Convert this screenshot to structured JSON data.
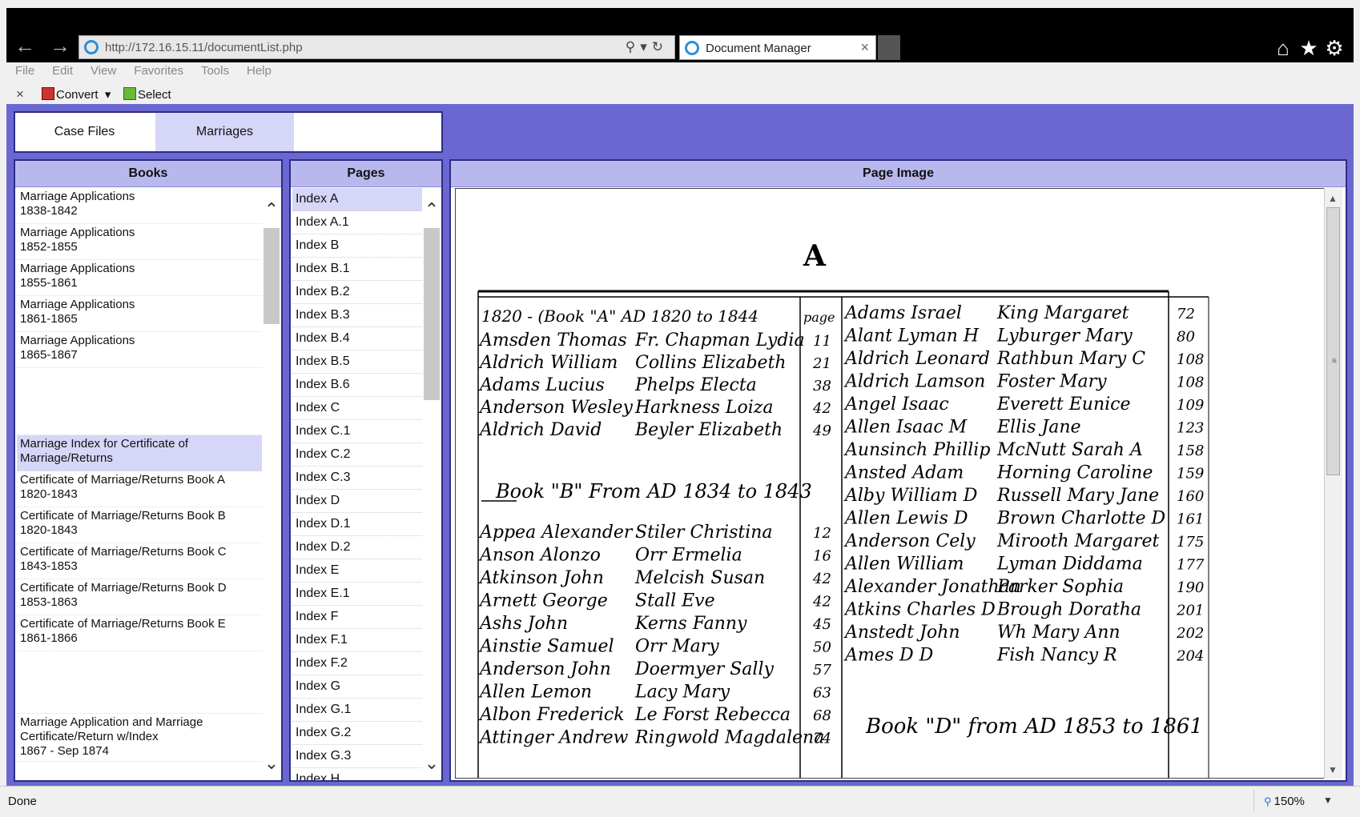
{
  "browser": {
    "url": "http://172.16.15.11/documentList.php",
    "tab_title": "Document Manager",
    "icons": [
      "back-arrow-icon",
      "forward-arrow-icon",
      "search-icon",
      "refresh-icon",
      "home-icon",
      "favorites-star-icon",
      "settings-gear-icon"
    ]
  },
  "menu": {
    "file": "File",
    "edit": "Edit",
    "view": "View",
    "favorites": "Favorites",
    "tools": "Tools",
    "help": "Help"
  },
  "commands": {
    "convert": "Convert",
    "select": "Select"
  },
  "tabs": [
    "Case Files",
    "Marriages"
  ],
  "books": {
    "header": "Books",
    "items": [
      {
        "line1": "Marriage Applications",
        "line2": "1838-1842"
      },
      {
        "line1": "Marriage Applications",
        "line2": "1852-1855"
      },
      {
        "line1": "Marriage Applications",
        "line2": "1855-1861"
      },
      {
        "line1": "Marriage Applications",
        "line2": "1861-1865"
      },
      {
        "line1": "Marriage Applications",
        "line2": "1865-1867"
      },
      {
        "line1": "Marriage Index for Certificate of",
        "line2": "Marriage/Returns"
      },
      {
        "line1": "Certificate of Marriage/Returns Book A",
        "line2": "1820-1843"
      },
      {
        "line1": "Certificate of Marriage/Returns Book B",
        "line2": "1820-1843"
      },
      {
        "line1": "Certificate of Marriage/Returns Book C",
        "line2": "1843-1853"
      },
      {
        "line1": "Certificate of Marriage/Returns Book D",
        "line2": "1853-1863"
      },
      {
        "line1": "Certificate of Marriage/Returns Book E",
        "line2": "1861-1866"
      },
      {
        "line1": "Marriage Application and Marriage",
        "line2": "Certificate/Return w/Index",
        "line3": "1867 - Sep 1874"
      }
    ]
  },
  "pages": {
    "header": "Pages",
    "items": [
      "Index A",
      "Index A.1",
      "Index B",
      "Index B.1",
      "Index B.2",
      "Index B.3",
      "Index B.4",
      "Index B.5",
      "Index B.6",
      "Index C",
      "Index C.1",
      "Index C.2",
      "Index C.3",
      "Index D",
      "Index D.1",
      "Index D.2",
      "Index E",
      "Index E.1",
      "Index F",
      "Index F.1",
      "Index F.2",
      "Index G",
      "Index G.1",
      "Index G.2",
      "Index G.3",
      "Index H"
    ]
  },
  "page_image": {
    "header": "Page Image",
    "heading_letter": "A",
    "col_header_left": "1820 - (Book \"A\" AD 1820 to 1844",
    "col_page_label": "page",
    "left_rows": [
      {
        "name": "Amsden Thomas",
        "spouse": "Fr. Chapman Lydia",
        "page": "11"
      },
      {
        "name": "Aldrich William",
        "spouse": "Collins Elizabeth",
        "page": "21"
      },
      {
        "name": "Adams Lucius",
        "spouse": "Phelps Electa",
        "page": "38"
      },
      {
        "name": "Anderson Wesley",
        "spouse": "Harkness Loiza",
        "page": "42"
      },
      {
        "name": "Aldrich David",
        "spouse": "Beyler Elizabeth",
        "page": "49"
      }
    ],
    "book_b_label": "Book \"B\" From AD 1834 to 1843",
    "left_rows_b": [
      {
        "name": "Appea Alexander",
        "spouse": "Stiler Christina",
        "page": "12"
      },
      {
        "name": "Anson Alonzo",
        "spouse": "Orr Ermelia",
        "page": "16"
      },
      {
        "name": "Atkinson John",
        "spouse": "Melcish Susan",
        "page": "42"
      },
      {
        "name": "Arnett George",
        "spouse": "Stall Eve",
        "page": "42"
      },
      {
        "name": "Ashs John",
        "spouse": "Kerns Fanny",
        "page": "45"
      },
      {
        "name": "Ainstie Samuel",
        "spouse": "Orr Mary",
        "page": "50"
      },
      {
        "name": "Anderson John",
        "spouse": "Doermyer Sally",
        "page": "57"
      },
      {
        "name": "Allen Lemon",
        "spouse": "Lacy Mary",
        "page": "63"
      },
      {
        "name": "Albon Frederick",
        "spouse": "Le Forst Rebecca",
        "page": "68"
      },
      {
        "name": "Attinger Andrew",
        "spouse": "Ringwold Magdalena",
        "page": "74"
      }
    ],
    "right_rows": [
      {
        "name": "Adams Israel",
        "spouse": "King Margaret",
        "page": "72"
      },
      {
        "name": "Alant Lyman H",
        "spouse": "Lyburger Mary",
        "page": "80"
      },
      {
        "name": "Aldrich Leonard",
        "spouse": "Rathbun Mary C",
        "page": "108"
      },
      {
        "name": "Aldrich Lamson",
        "spouse": "Foster Mary",
        "page": "108"
      },
      {
        "name": "Angel Isaac",
        "spouse": "Everett Eunice",
        "page": "109"
      },
      {
        "name": "Allen Isaac M",
        "spouse": "Ellis Jane",
        "page": "123"
      },
      {
        "name": "Aunsinch Phillip",
        "spouse": "McNutt Sarah A",
        "page": "158"
      },
      {
        "name": "Ansted Adam",
        "spouse": "Horning Caroline",
        "page": "159"
      },
      {
        "name": "Alby William D",
        "spouse": "Russell Mary Jane",
        "page": "160"
      },
      {
        "name": "Allen Lewis D",
        "spouse": "Brown Charlotte D",
        "page": "161"
      },
      {
        "name": "Anderson Cely",
        "spouse": "Mirooth Margaret",
        "page": "175"
      },
      {
        "name": "Allen William",
        "spouse": "Lyman Diddama",
        "page": "177"
      },
      {
        "name": "Alexander Jonathan",
        "spouse": "Parker Sophia",
        "page": "190"
      },
      {
        "name": "Atkins Charles D",
        "spouse": "Brough Doratha",
        "page": "201"
      },
      {
        "name": "Anstedt John",
        "spouse": "Wh Mary Ann",
        "page": "202"
      },
      {
        "name": "Ames D D",
        "spouse": "Fish Nancy R",
        "page": "204"
      }
    ],
    "book_d_label": "Book \"D\" from AD 1853 to 1861"
  },
  "status": {
    "text": "Done",
    "zoom": "150%"
  }
}
